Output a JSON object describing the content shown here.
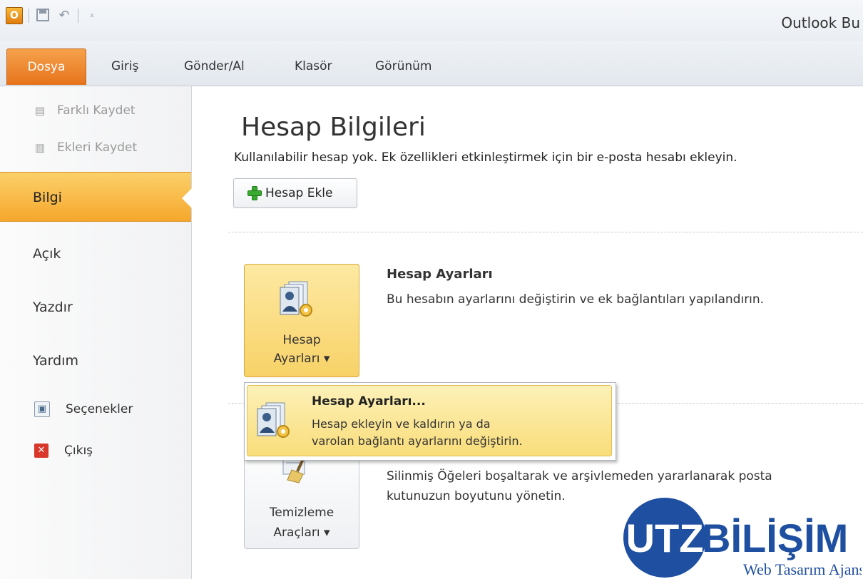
{
  "window": {
    "title": "Outlook Bu"
  },
  "tabs": [
    "Dosya",
    "Giriş",
    "Gönder/Al",
    "Klasör",
    "Görünüm"
  ],
  "nav": {
    "commands": [
      "Farklı Kaydet",
      "Ekleri Kaydet"
    ],
    "items": [
      "Bilgi",
      "Açık",
      "Yazdır",
      "Yardım"
    ],
    "active": "Bilgi",
    "options": "Seçenekler",
    "exit": "Çıkış"
  },
  "main": {
    "title": "Hesap Bilgileri",
    "subtitle": "Kullanılabilir hesap yok. Ek özellikleri etkinleştirmek için bir e-posta hesabı ekleyin.",
    "add_account": "Hesap Ekle",
    "account_settings": {
      "button_line1": "Hesap",
      "button_line2": "Ayarları ▾",
      "heading": "Hesap Ayarları",
      "description": "Bu hesabın ayarlarını değiştirin ve ek bağlantıları yapılandırın."
    },
    "cleanup": {
      "button_line1": "Temizleme",
      "button_line2": "Araçları ▾",
      "description_line1": "Silinmiş Öğeleri boşaltarak ve arşivlemeden yararlanarak posta",
      "description_line2": "kutunuzun boyutunu yönetin."
    }
  },
  "dropdown": {
    "title": "Hesap Ayarları...",
    "desc_line1": "Hesap ekleyin ve kaldırın ya da",
    "desc_line2": "varolan bağlantı ayarlarını değiştirin."
  },
  "watermark": {
    "line1_a": "UTZ",
    "line1_b": "BİLİŞİM",
    "line2": "Web Tasarım Ajansı"
  },
  "colors": {
    "accent_orange": "#f6a72c",
    "hover_yellow": "#f9dd7a",
    "file_tab": "#e6731b"
  },
  "icons": [
    "outlook-app-icon",
    "save-icon",
    "undo-icon",
    "customize-qat-icon",
    "save-as-icon",
    "save-attachments-icon",
    "options-icon",
    "exit-icon",
    "plus-icon",
    "account-settings-icon",
    "cleanup-tools-icon"
  ]
}
